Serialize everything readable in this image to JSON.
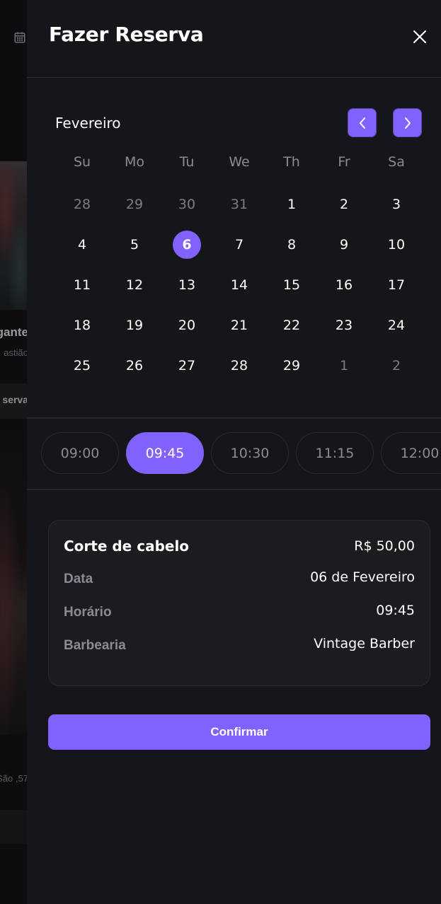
{
  "background": {
    "title_fragment": "gante",
    "subtitle_fragment": "astião",
    "button_fragment": "serva",
    "address_fragment": "57, São"
  },
  "sheet": {
    "title": "Fazer Reserva"
  },
  "calendar": {
    "month": "Fevereiro",
    "weekdays": [
      "Su",
      "Mo",
      "Tu",
      "We",
      "Th",
      "Fr",
      "Sa"
    ],
    "selected_day": "6",
    "weeks": [
      [
        {
          "d": "28",
          "out": true
        },
        {
          "d": "29",
          "out": true
        },
        {
          "d": "30",
          "out": true
        },
        {
          "d": "31",
          "out": true
        },
        {
          "d": "1"
        },
        {
          "d": "2"
        },
        {
          "d": "3"
        }
      ],
      [
        {
          "d": "4"
        },
        {
          "d": "5"
        },
        {
          "d": "6",
          "sel": true
        },
        {
          "d": "7"
        },
        {
          "d": "8"
        },
        {
          "d": "9"
        },
        {
          "d": "10"
        }
      ],
      [
        {
          "d": "11"
        },
        {
          "d": "12"
        },
        {
          "d": "13"
        },
        {
          "d": "14"
        },
        {
          "d": "15"
        },
        {
          "d": "16"
        },
        {
          "d": "17"
        }
      ],
      [
        {
          "d": "18"
        },
        {
          "d": "19"
        },
        {
          "d": "20"
        },
        {
          "d": "21"
        },
        {
          "d": "22"
        },
        {
          "d": "23"
        },
        {
          "d": "24"
        }
      ],
      [
        {
          "d": "25"
        },
        {
          "d": "26"
        },
        {
          "d": "27"
        },
        {
          "d": "28"
        },
        {
          "d": "29"
        },
        {
          "d": "1",
          "out": true
        },
        {
          "d": "2",
          "out": true
        }
      ]
    ]
  },
  "time_slots": {
    "selected": "09:45",
    "items": [
      "09:00",
      "09:45",
      "10:30",
      "11:15",
      "12:00"
    ]
  },
  "summary": {
    "service": "Corte de cabelo",
    "price": "R$ 50,00",
    "rows": [
      {
        "label": "Data",
        "value": "06 de Fevereiro"
      },
      {
        "label": "Horário",
        "value": "09:45"
      },
      {
        "label": "Barbearia",
        "value": "Vintage Barber"
      }
    ]
  },
  "confirm_label": "Confirmar",
  "colors": {
    "accent": "#8162ff",
    "sheet_bg": "#151619",
    "muted_text": "#8b8c93"
  }
}
